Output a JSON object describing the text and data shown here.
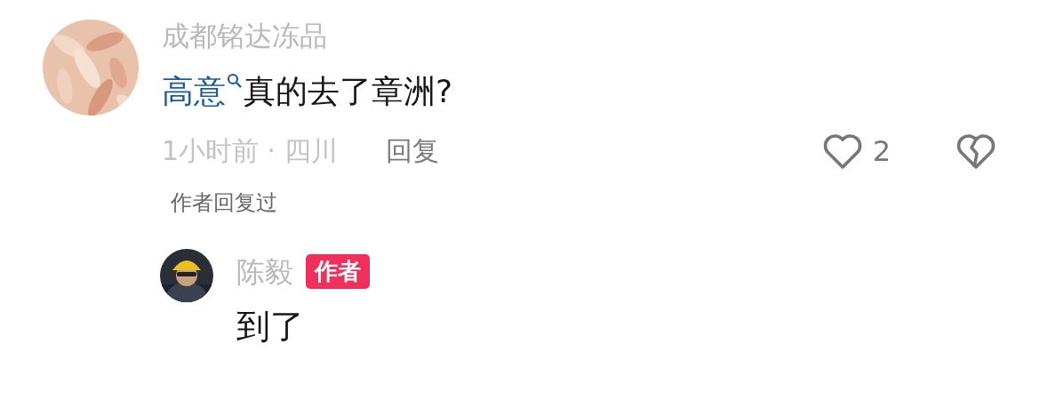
{
  "comment": {
    "username": "成都铭达冻品",
    "mention": "高意",
    "text": "真的去了章洲?",
    "meta": "1小时前 · 四川",
    "reply_button": "回复",
    "likes": "2",
    "liked": false,
    "author_replied": "作者回复过"
  },
  "reply": {
    "username": "陈毅",
    "badge": "作者",
    "text": "到了"
  }
}
